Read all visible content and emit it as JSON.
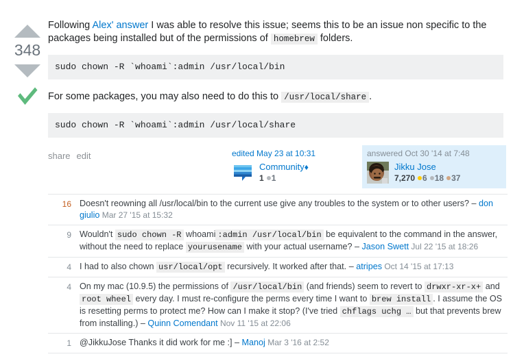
{
  "answer": {
    "vote_count": "348",
    "is_accepted": true,
    "accepted_color": "#5eba7d",
    "arrow_color": "#b4bbc0",
    "body": {
      "paragraph1": {
        "pre_link": "Following ",
        "link_text": "Alex' answer",
        "post_link": " I was able to resolve this issue; seems this to be an issue non specific to the packages being installed but of the permissions of ",
        "inline_code": "homebrew",
        "tail": " folders."
      },
      "code_block_1": "sudo chown -R `whoami`:admin /usr/local/bin",
      "paragraph2": {
        "lead": "For some packages, you may also need to do this to ",
        "inline_code": "/usr/local/share",
        "tail": "."
      },
      "code_block_2": "sudo chown -R `whoami`:admin /usr/local/share"
    },
    "post_menu": {
      "share": "share",
      "edit": "edit"
    },
    "editor_signature": {
      "action_text": "edited May 23 at 10:31",
      "username": "Community",
      "moderator_diamond": "♦",
      "reputation": "1",
      "badges": [
        {
          "tier": "silver",
          "count": "1"
        }
      ],
      "avatar_name": "community-avatar"
    },
    "owner_signature": {
      "action_text": "answered Oct 30 '14 at 7:48",
      "username": "Jikku Jose",
      "reputation": "7,270",
      "badges": [
        {
          "tier": "gold",
          "count": "6"
        },
        {
          "tier": "silver",
          "count": "18"
        },
        {
          "tier": "bronze",
          "count": "37"
        }
      ],
      "card_background": "#deeffb",
      "avatar_name": "user-avatar-jikku-jose"
    }
  },
  "comments": [
    {
      "score": "16",
      "hot": true,
      "segments": [
        {
          "type": "text",
          "value": "Doesn't reowning all /usr/local/bin to the current use give any troubles to the system or to other users? "
        },
        {
          "type": "dash",
          "value": "– "
        },
        {
          "type": "user",
          "value": "don giulio"
        },
        {
          "type": "date",
          "value": " Mar 27 '15 at 15:32"
        }
      ]
    },
    {
      "score": "9",
      "hot": false,
      "segments": [
        {
          "type": "text",
          "value": "Wouldn't "
        },
        {
          "type": "code",
          "value": "sudo chown -R"
        },
        {
          "type": "text",
          "value": " whoami"
        },
        {
          "type": "code",
          "value": ":admin /usr/local/bin"
        },
        {
          "type": "text",
          "value": " be equivalent to the command in the answer, without the need to replace "
        },
        {
          "type": "code",
          "value": "yourusename"
        },
        {
          "type": "text",
          "value": " with your actual username? "
        },
        {
          "type": "dash",
          "value": "– "
        },
        {
          "type": "user",
          "value": "Jason Swett"
        },
        {
          "type": "date",
          "value": " Jul 22 '15 at 18:26"
        }
      ]
    },
    {
      "score": "4",
      "hot": false,
      "segments": [
        {
          "type": "text",
          "value": "I had to also chown "
        },
        {
          "type": "code",
          "value": "usr/local/opt"
        },
        {
          "type": "text",
          "value": " recursively. It worked after that. "
        },
        {
          "type": "dash",
          "value": "– "
        },
        {
          "type": "user",
          "value": "atripes"
        },
        {
          "type": "date",
          "value": " Oct 14 '15 at 17:13"
        }
      ]
    },
    {
      "score": "4",
      "hot": false,
      "segments": [
        {
          "type": "text",
          "value": "On my mac (10.9.5) the permissions of "
        },
        {
          "type": "code",
          "value": "/usr/local/bin"
        },
        {
          "type": "text",
          "value": " (and friends) seem to revert to "
        },
        {
          "type": "code",
          "value": "drwxr-xr-x+"
        },
        {
          "type": "text",
          "value": " and "
        },
        {
          "type": "code",
          "value": "root wheel"
        },
        {
          "type": "text",
          "value": " every day. I must re-configure the perms every time I want to "
        },
        {
          "type": "code",
          "value": "brew install"
        },
        {
          "type": "text",
          "value": ". I assume the OS is resetting perms to protect me? How can I make it stop? (I've tried "
        },
        {
          "type": "code",
          "value": "chflags uchg …"
        },
        {
          "type": "text",
          "value": " but that prevents brew from installing.) "
        },
        {
          "type": "dash",
          "value": "– "
        },
        {
          "type": "user",
          "value": "Quinn Comendant"
        },
        {
          "type": "date",
          "value": " Nov 11 '15 at 22:06"
        }
      ]
    },
    {
      "score": "1",
      "hot": false,
      "segments": [
        {
          "type": "text",
          "value": "@JikkuJose Thanks it did work for me :] "
        },
        {
          "type": "dash",
          "value": "– "
        },
        {
          "type": "user",
          "value": "Manoj"
        },
        {
          "type": "date",
          "value": " Mar 3 '16 at 2:52"
        }
      ]
    }
  ],
  "colors": {
    "link": "#0077cc",
    "code_bg": "#eff0f1",
    "inline_code_bg": "#eeeeee",
    "accepted_green": "#5eba7d",
    "hot_comment": "#c45f20",
    "owner_card_bg": "#deeffb"
  }
}
